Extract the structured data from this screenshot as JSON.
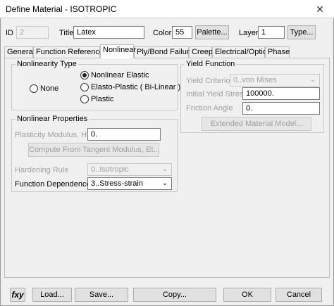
{
  "window": {
    "title": "Define Material - ISOTROPIC",
    "close_glyph": "✕"
  },
  "header": {
    "id_label": "ID",
    "id_value": "2",
    "title_label": "Title",
    "title_value": "Latex",
    "color_label": "Color",
    "color_value": "55",
    "palette_label": "Palette...",
    "layer_label": "Layer",
    "layer_value": "1",
    "type_label": "Type..."
  },
  "tabs": [
    "General",
    "Function References",
    "Nonlinear",
    "Ply/Bond Failure",
    "Creep",
    "Electrical/Optical",
    "Phase"
  ],
  "active_tab": "Nonlinear",
  "nonlinearity_type": {
    "title": "Nonlinearity Type",
    "options": [
      "None",
      "Nonlinear Elastic",
      "Elasto-Plastic ( Bi-Linear )",
      "Plastic"
    ],
    "selected": "Nonlinear Elastic"
  },
  "yield_function": {
    "title": "Yield Function",
    "criterion_label": "Yield Criterion",
    "criterion_value": "0..von Mises",
    "initial_stress_label": "Initial Yield Stress",
    "initial_stress_value": "100000.",
    "friction_label": "Friction Angle",
    "friction_value": "0.",
    "extended_label": "Extended Material Model..."
  },
  "nonlinear_properties": {
    "title": "Nonlinear Properties",
    "plasticity_label": "Plasticity Modulus, H",
    "plasticity_value": "0.",
    "compute_label": "Compute From Tangent Modulus, Et...",
    "hardening_label": "Hardening Rule",
    "hardening_value": "0..Isotropic",
    "function_dep_label": "Function Dependence",
    "function_dep_value": "3..Stress-strain"
  },
  "bottom": {
    "fxy_label": "fxy",
    "load_label": "Load...",
    "save_label": "Save...",
    "copy_label": "Copy...",
    "ok_label": "OK",
    "cancel_label": "Cancel"
  }
}
